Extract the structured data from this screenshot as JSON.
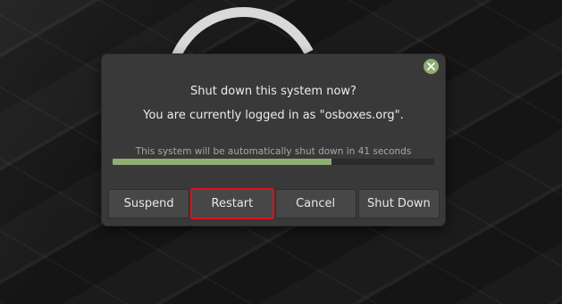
{
  "dialog": {
    "close_icon": "close-icon",
    "title": "Shut down this system now?",
    "subtitle": "You are currently logged in as \"osboxes.org\".",
    "countdown_text": "This system will be automatically shut down in 41 seconds",
    "progress_fraction": 0.68,
    "buttons": {
      "suspend": "Suspend",
      "restart": "Restart",
      "cancel": "Cancel",
      "shutdown": "Shut Down"
    }
  },
  "colors": {
    "accent": "#8fae72",
    "highlight": "#e0101a",
    "dialog_bg": "#393939"
  }
}
